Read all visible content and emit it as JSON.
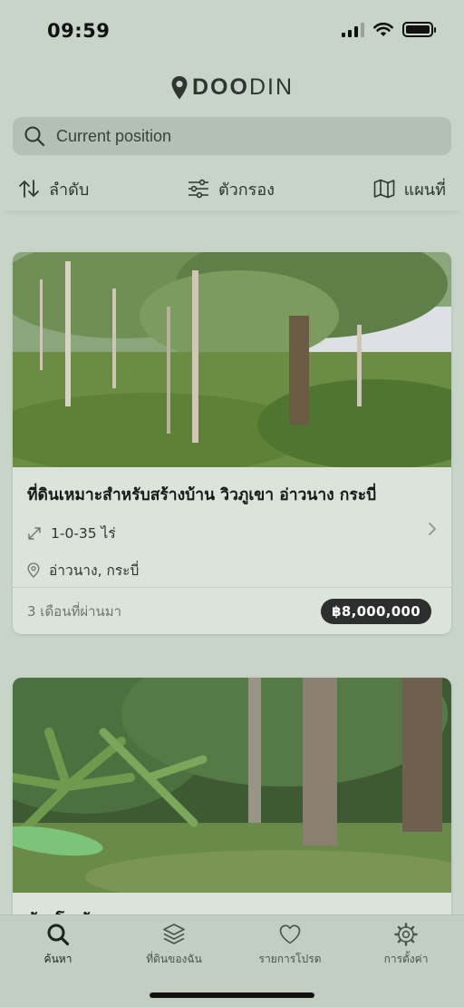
{
  "status": {
    "time": "09:59"
  },
  "brand": {
    "logo_bold": "DOO",
    "logo_thin": "DIN"
  },
  "search": {
    "placeholder": "Current position"
  },
  "toolbar": {
    "sort_label": "ลำดับ",
    "filter_label": "ตัวกรอง",
    "map_label": "แผนที่"
  },
  "listings": [
    {
      "title": "ที่ดินเหมาะสำหรับสร้างบ้าน วิวภูเขา อ่าวนาง กระบี่",
      "area": "1-0-35 ไร่",
      "location": "อ่าวนาง, กระบี่",
      "posted": "3 เดือนที่ผ่านมา",
      "price": "฿8,000,000"
    },
    {
      "title": "ท้ายโรงล้าง"
    }
  ],
  "tabs": {
    "search": "ค้นหา",
    "my_land": "ที่ดินของฉัน",
    "favorites": "รายการโปรด",
    "settings": "การตั้งค่า"
  },
  "colors": {
    "background": "#c8d4c8",
    "card": "#dbe3db",
    "price_badge": "#2d2f2e"
  }
}
